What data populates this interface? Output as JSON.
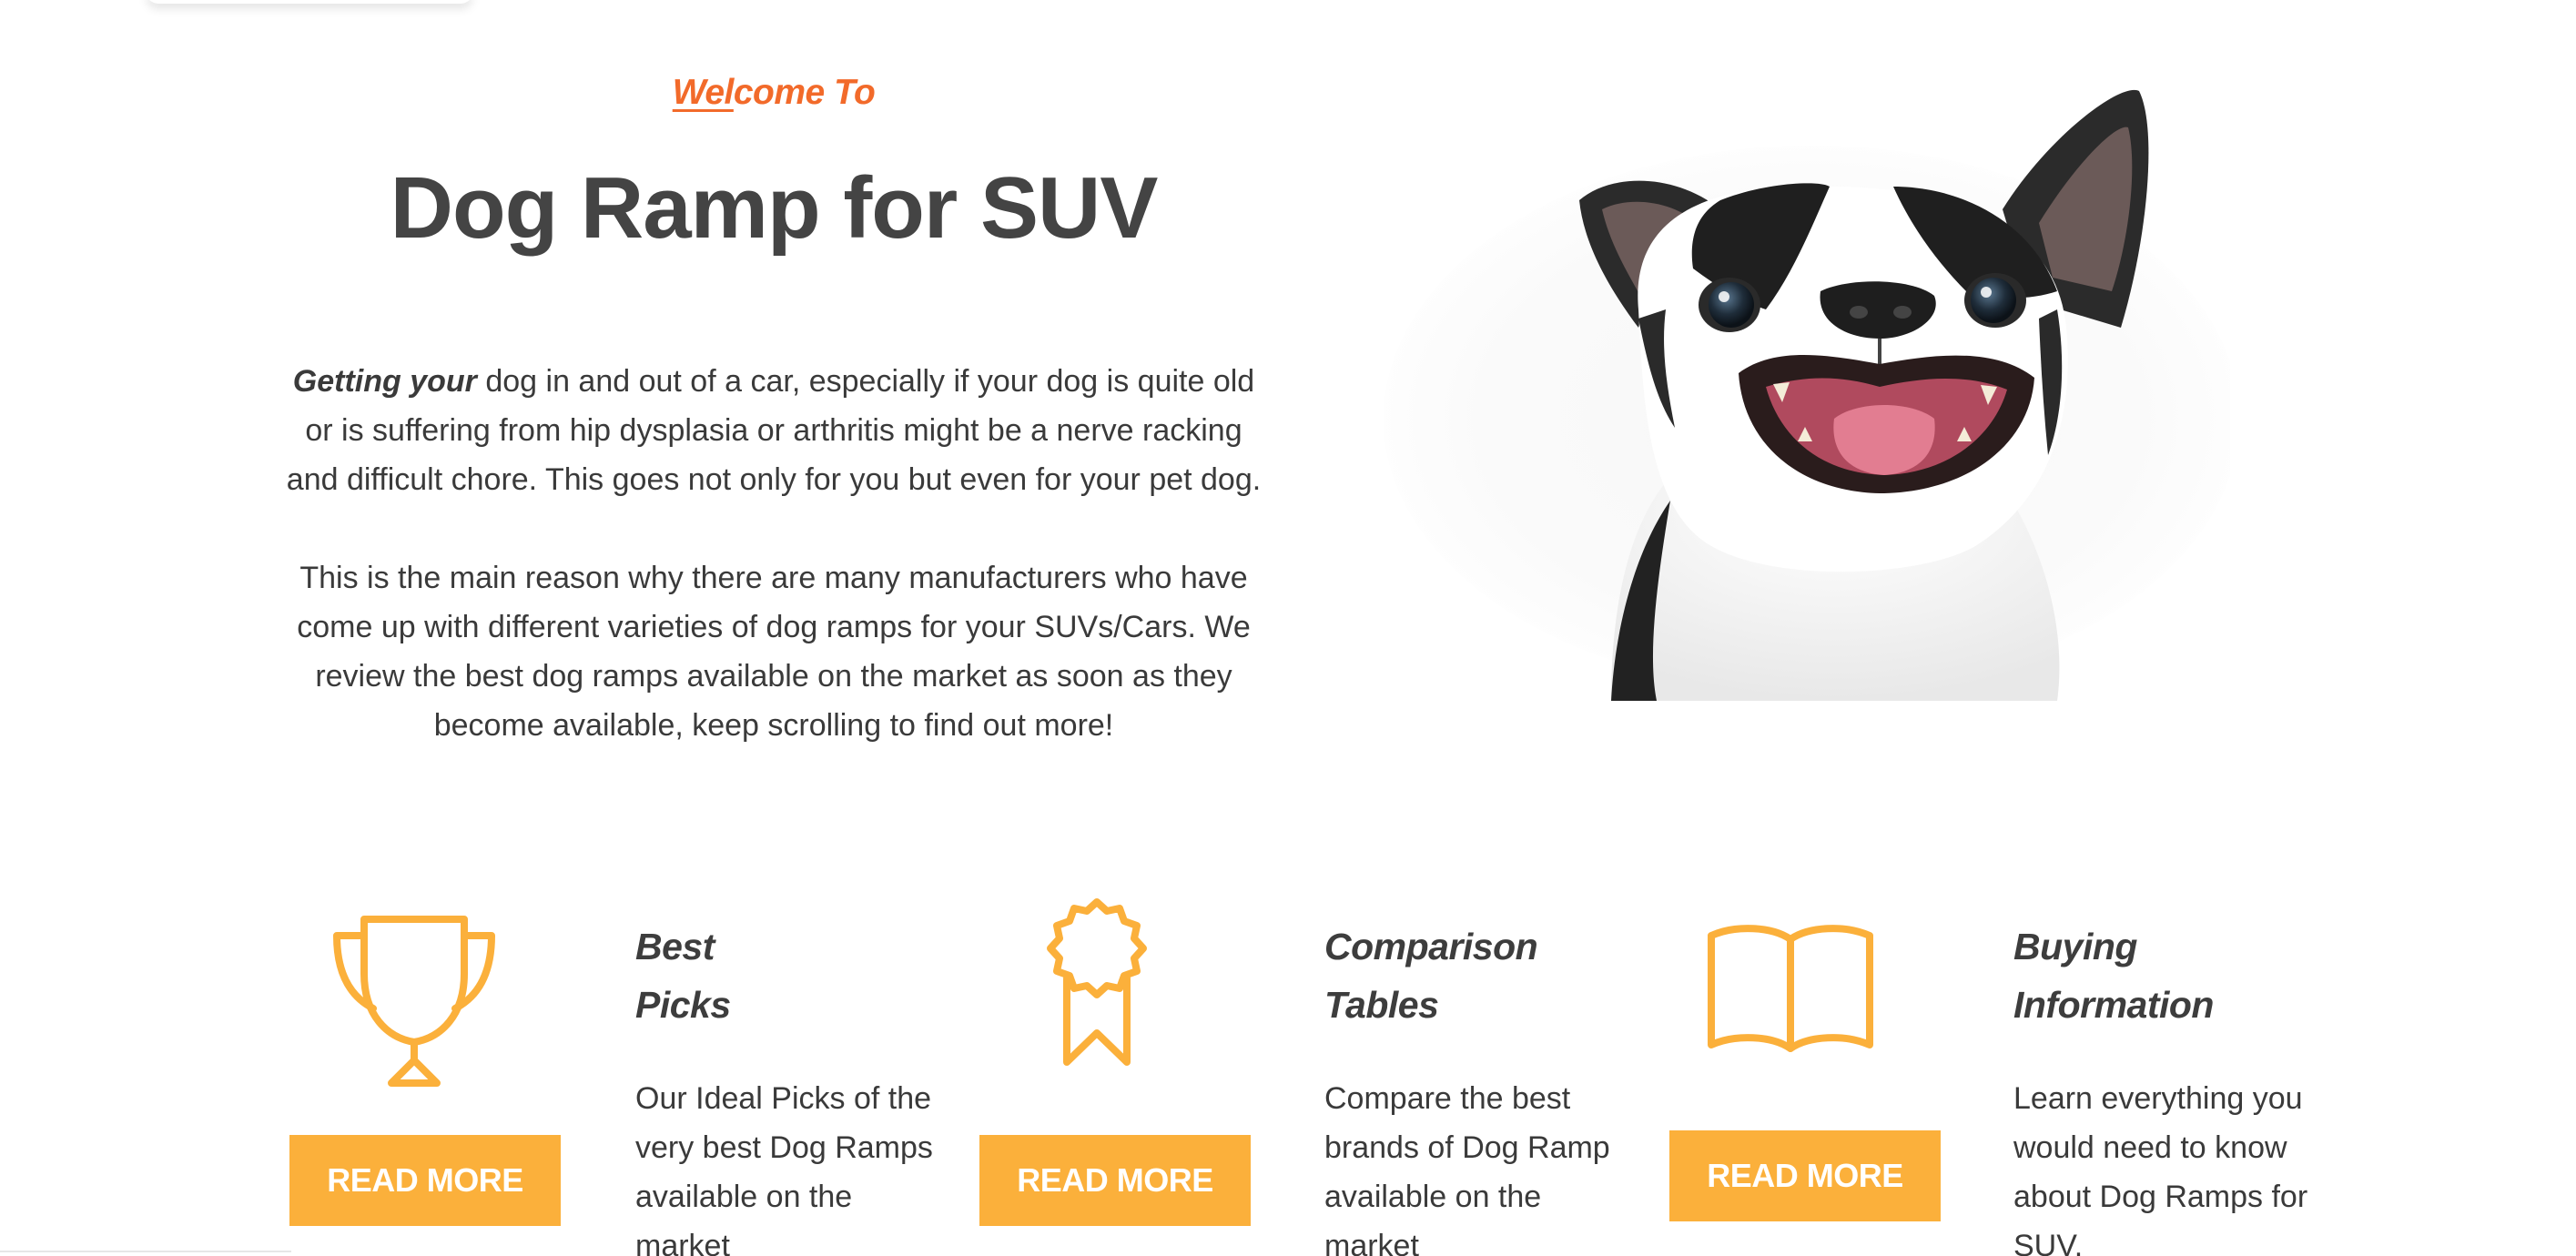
{
  "hero": {
    "welcome_underlined": "Wel",
    "welcome_rest": "come To",
    "title": "Dog Ramp for SUV",
    "intro_bold": "Getting your",
    "intro_rest": " dog in and out of a car, especially if your dog is quite old or is suffering from hip dysplasia or arthritis might be a nerve racking and difficult chore. This goes not only for you but even for your pet dog.",
    "paragraph2": "This is the main reason why there are many manufacturers who have come up with different varieties of dog ramps for your SUVs/Cars. We review the best dog ramps available on the market as soon as they become available, keep scrolling to find out more!"
  },
  "features": [
    {
      "icon": "trophy-icon",
      "button": "READ MORE",
      "title_line1": "Best",
      "title_line2": "Picks",
      "description": "Our Ideal Picks of the very best Dog Ramps available on the market"
    },
    {
      "icon": "award-ribbon-icon",
      "button": "READ MORE",
      "title_line1": "Comparison",
      "title_line2": "Tables",
      "description": "Compare the best brands of Dog Ramp available on the market"
    },
    {
      "icon": "open-book-icon",
      "button": "READ MORE",
      "title_line1": "Buying",
      "title_line2": "Information",
      "description": "Learn everything you would need to know about Dog Ramps for SUV."
    }
  ],
  "colors": {
    "accent": "#fbb03b",
    "welcome": "#f26a2a",
    "text": "#3d3d3d"
  }
}
